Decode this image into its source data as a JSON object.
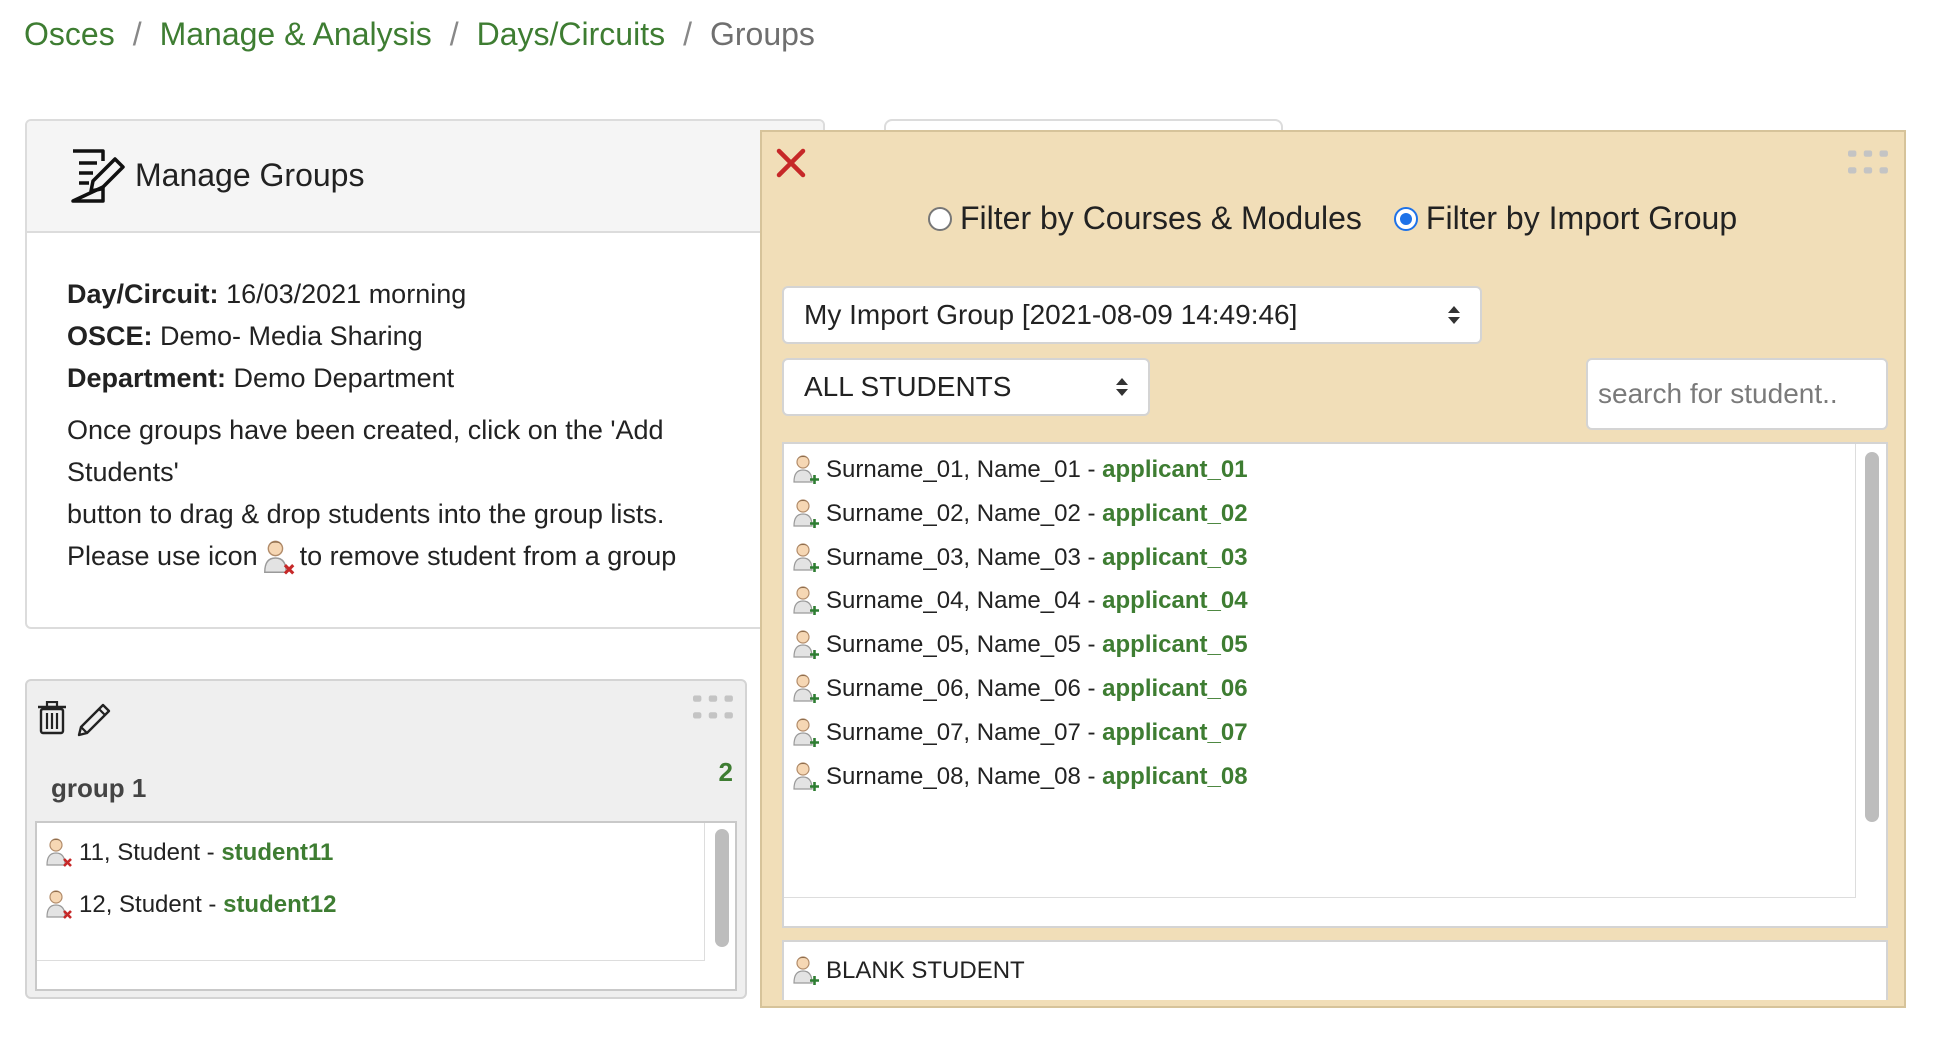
{
  "breadcrumb": {
    "items": [
      "Osces",
      "Manage & Analysis",
      "Days/Circuits"
    ],
    "current": "Groups",
    "separator": "/"
  },
  "manage": {
    "title": "Manage Groups",
    "day_label": "Day/Circuit:",
    "day_value": "16/03/2021 morning",
    "osce_label": "OSCE:",
    "osce_value": "Demo- Media Sharing",
    "dept_label": "Department:",
    "dept_value": "Demo Department",
    "note1": "Once groups have been created, click on the 'Add Students'",
    "note2": "button to drag & drop students into the group lists.",
    "note3_pre": "Please use icon",
    "note3_post": "to remove student from a group"
  },
  "group": {
    "name": "group 1",
    "count": "2",
    "members": [
      {
        "name": "11, Student",
        "sep": " - ",
        "username": "student11"
      },
      {
        "name": "12, Student",
        "sep": " - ",
        "username": "student12"
      }
    ]
  },
  "panel": {
    "filter_courses": "Filter by Courses & Modules",
    "filter_import": "Filter by Import Group",
    "selected_filter": "import",
    "import_group": "My Import Group [2021-08-09 14:49:46]",
    "students_filter": "ALL STUDENTS",
    "search_placeholder": "search for student..",
    "students": [
      {
        "name": "Surname_01, Name_01",
        "sep": " - ",
        "username": "applicant_01"
      },
      {
        "name": "Surname_02, Name_02",
        "sep": " - ",
        "username": "applicant_02"
      },
      {
        "name": "Surname_03, Name_03",
        "sep": " - ",
        "username": "applicant_03"
      },
      {
        "name": "Surname_04, Name_04",
        "sep": " - ",
        "username": "applicant_04"
      },
      {
        "name": "Surname_05, Name_05",
        "sep": " - ",
        "username": "applicant_05"
      },
      {
        "name": "Surname_06, Name_06",
        "sep": " - ",
        "username": "applicant_06"
      },
      {
        "name": "Surname_07, Name_07",
        "sep": " - ",
        "username": "applicant_07"
      },
      {
        "name": "Surname_08, Name_08",
        "sep": " - ",
        "username": "applicant_08"
      }
    ],
    "blank_student": "BLANK STUDENT"
  },
  "colors": {
    "link_green": "#3e7d32",
    "panel_bg": "#f1deb8",
    "close_red": "#c62828",
    "radio_blue": "#1e72e8"
  },
  "icons": {
    "add_student": "user-add-icon",
    "remove_student": "user-remove-icon",
    "close": "close-icon",
    "drag": "drag-handle-icon",
    "trash": "trash-icon",
    "edit": "pencil-icon",
    "manage": "edit-document-icon"
  }
}
